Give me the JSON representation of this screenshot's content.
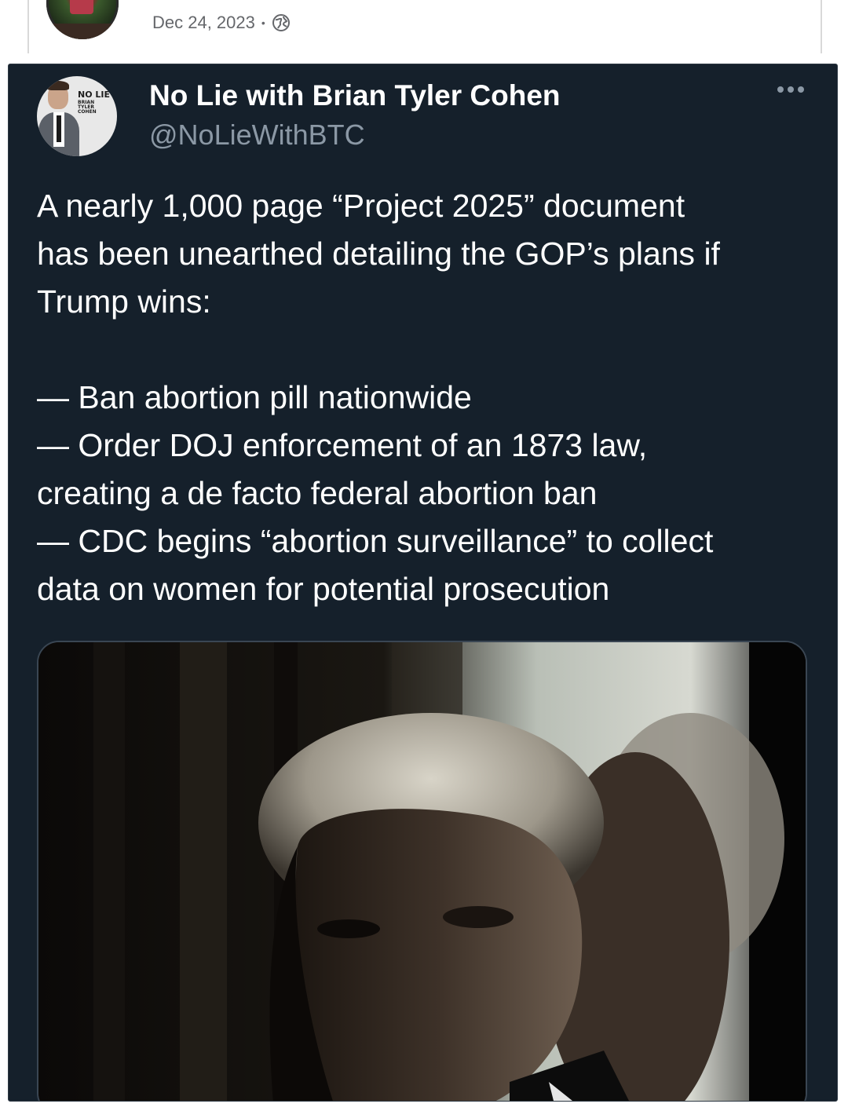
{
  "outer_post": {
    "date": "Dec 24, 2023",
    "separator": "•",
    "privacy_icon": "globe-icon"
  },
  "tweet": {
    "display_name": "No Lie with Brian Tyler Cohen",
    "handle": "@NoLieWithBTC",
    "avatar_logo": {
      "line1": "NO LIE",
      "line2": "BRIAN TYLER COHEN"
    },
    "more_icon": "more-horizontal-icon",
    "intro_lines": [
      "A nearly 1,000 page “Project 2025” document",
      "has been unearthed detailing the GOP’s plans if",
      "Trump wins:"
    ],
    "list_lines": [
      "— Ban abortion pill nationwide",
      "— Order DOJ enforcement of an 1873 law,",
      "creating a de facto federal abortion ban",
      "— CDC begins “abortion surveillance” to collect",
      "data on women for potential prosecution"
    ]
  },
  "colors": {
    "tweet_bg": "#15202b",
    "text_primary": "#ffffff",
    "text_secondary": "#8b98a5",
    "meta_gray": "#65676b"
  }
}
